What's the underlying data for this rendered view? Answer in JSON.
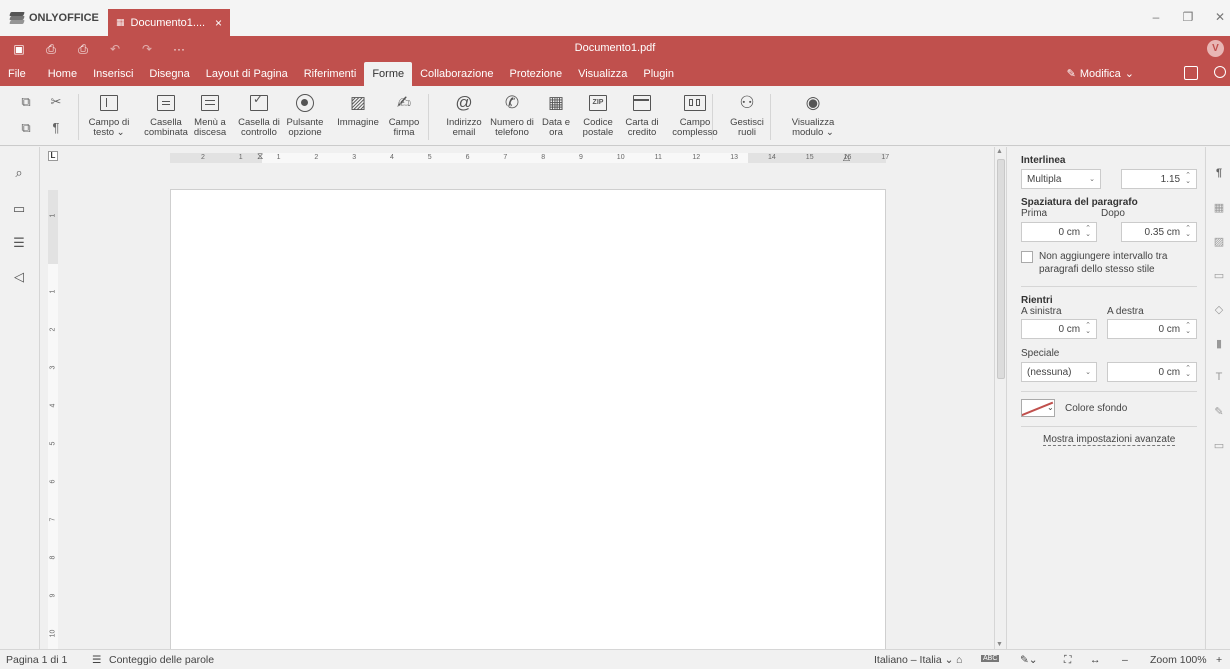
{
  "window": {
    "app_name": "ONLYOFFICE",
    "tab_title": "Documento1....",
    "tab_close": "×",
    "doc_title": "Documento1.pdf",
    "user_initial": "V"
  },
  "menu": {
    "tabs": [
      "File",
      "Home",
      "Inserisci",
      "Disegna",
      "Layout di Pagina",
      "Riferimenti",
      "Forme",
      "Collaborazione",
      "Protezione",
      "Visualizza",
      "Plugin"
    ],
    "active_tab": "Forme",
    "edit_mode": "Modifica"
  },
  "toolbar": {
    "buttons": [
      {
        "label1": "Campo di",
        "label2": "testo ⌄",
        "icon": "text-field-icon"
      },
      {
        "label1": "Casella",
        "label2": "combinata",
        "icon": "combo-box-icon"
      },
      {
        "label1": "Menù a",
        "label2": "discesa",
        "icon": "dropdown-icon"
      },
      {
        "label1": "Casella di",
        "label2": "controllo",
        "icon": "checkbox-icon"
      },
      {
        "label1": "Pulsante",
        "label2": "opzione",
        "icon": "radio-button-icon"
      },
      {
        "label1": "Immagine",
        "label2": "",
        "icon": "image-icon"
      },
      {
        "label1": "Campo",
        "label2": "firma",
        "icon": "signature-icon"
      },
      {
        "label1": "Indirizzo",
        "label2": "email",
        "icon": "email-icon"
      },
      {
        "label1": "Numero di",
        "label2": "telefono",
        "icon": "phone-icon"
      },
      {
        "label1": "Data e",
        "label2": "ora",
        "icon": "datetime-icon"
      },
      {
        "label1": "Codice",
        "label2": "postale",
        "icon": "zip-icon"
      },
      {
        "label1": "Carta di",
        "label2": "credito",
        "icon": "credit-card-icon"
      },
      {
        "label1": "Campo",
        "label2": "complesso",
        "icon": "complex-field-icon"
      },
      {
        "label1": "Gestisci",
        "label2": "ruoli",
        "icon": "roles-icon"
      },
      {
        "label1": "Visualizza",
        "label2": "modulo ⌄",
        "icon": "view-form-icon"
      }
    ]
  },
  "ruler": {
    "h_marks": [
      "2",
      "1",
      "1",
      "2",
      "3",
      "4",
      "5",
      "6",
      "7",
      "8",
      "9",
      "10",
      "11",
      "12",
      "13",
      "14",
      "15",
      "16",
      "17"
    ],
    "v_marks": [
      "1",
      "1",
      "2",
      "3",
      "4",
      "5",
      "6",
      "7",
      "8",
      "9",
      "10",
      "11"
    ],
    "tab_stop": "L"
  },
  "paragraph": {
    "line_spacing_label": "Interlinea",
    "line_spacing_type": "Multipla",
    "line_spacing_value": "1.15",
    "spacing_label": "Spaziatura del paragrafo",
    "before_label": "Prima",
    "after_label": "Dopo",
    "before_value": "0 cm",
    "after_value": "0.35 cm",
    "no_interval_line1": "Non aggiungere intervallo tra",
    "no_interval_line2": "paragrafi dello stesso stile",
    "indents_label": "Rientri",
    "left_label": "A sinistra",
    "right_label": "A destra",
    "left_value": "0 cm",
    "right_value": "0 cm",
    "special_label": "Speciale",
    "special_type": "(nessuna)",
    "special_value": "0 cm",
    "bg_color_label": "Colore sfondo",
    "advanced_link": "Mostra impostazioni avanzate"
  },
  "status": {
    "page": "Pagina 1 di 1",
    "word_count": "Conteggio delle parole",
    "language": "Italiano – Italia ⌄",
    "zoom": "Zoom 100%",
    "zoom_minus": "–",
    "zoom_plus": "+"
  }
}
